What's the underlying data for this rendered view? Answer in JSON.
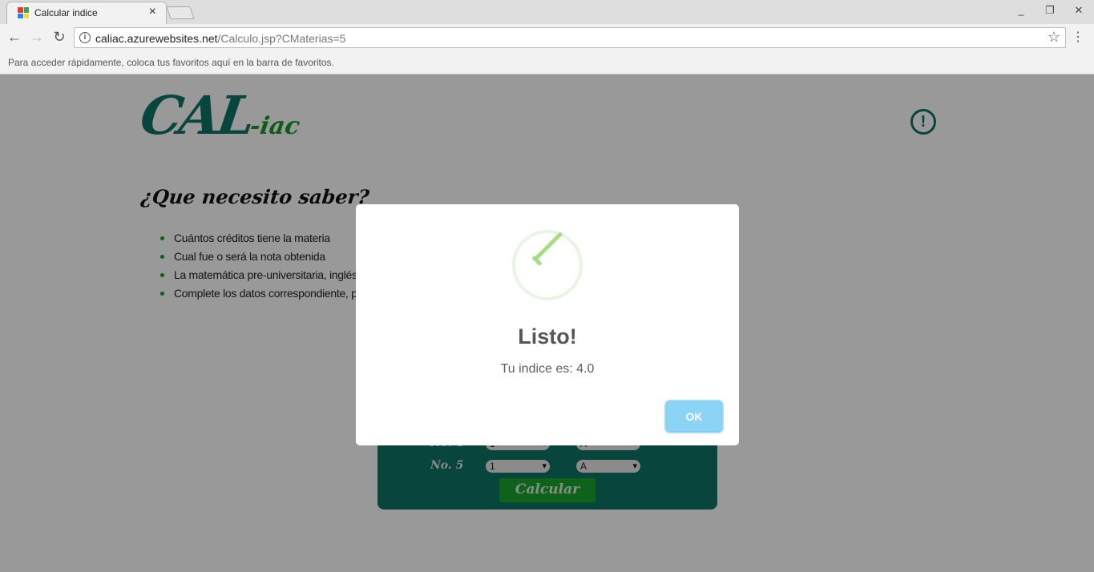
{
  "browser": {
    "tab_title": "Calcular indice",
    "tab_close": "×",
    "url_host": "caliac.azurewebsites.net",
    "url_path": "/Calculo.jsp?CMaterias=5",
    "bookmarks_hint": "Para acceder rápidamente, coloca tus favoritos aquí en la barra de favoritos."
  },
  "page": {
    "logo_main": "CAL",
    "logo_sub": "-iac",
    "heading": "¿Que necesito saber?",
    "items": [
      "Cuántos créditos tiene la materia",
      "Cual fue o será la nota obtenida",
      "La matemática pre-universitaria, inglés y e",
      "Complete los datos correspondiente, pres"
    ],
    "rows": [
      {
        "label": "No. 4",
        "credits": "1",
        "grade": "A"
      },
      {
        "label": "No. 5",
        "credits": "1",
        "grade": "A"
      }
    ],
    "calculate_label": "Calcular"
  },
  "modal": {
    "title": "Listo!",
    "text": "Tu indice es: 4.0",
    "ok_label": "OK"
  },
  "colors": {
    "brand_teal": "#0e7566",
    "brand_green": "#1a9a2a",
    "confirm_button": "#8cd4f5",
    "success_check": "#a5dc86"
  }
}
